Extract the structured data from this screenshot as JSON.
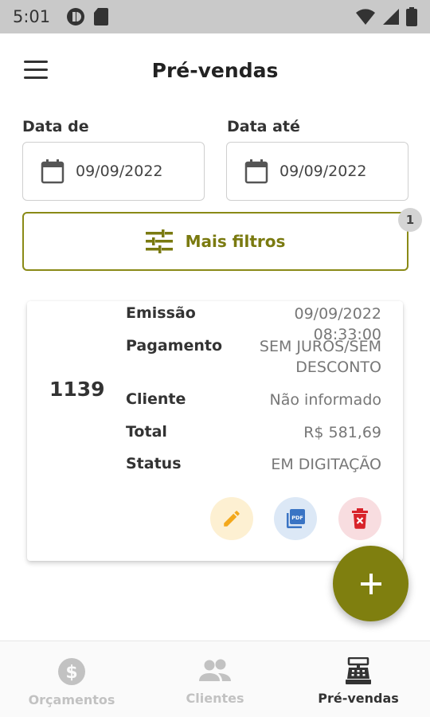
{
  "status_bar": {
    "time": "5:01",
    "icons": [
      "clock-badge-icon",
      "sd-card-icon",
      "wifi-icon",
      "signal-icon",
      "battery-icon"
    ]
  },
  "header": {
    "title": "Pré-vendas",
    "menu_icon": "hamburger-menu-icon"
  },
  "filters": {
    "date_from": {
      "label": "Data de",
      "value": "09/09/2022",
      "icon": "calendar-icon"
    },
    "date_to": {
      "label": "Data até",
      "value": "09/09/2022",
      "icon": "calendar-icon"
    },
    "more_filters": {
      "label": "Mais filtros",
      "icon": "tune-icon",
      "badge": "1"
    }
  },
  "card": {
    "number": "1139",
    "rows": [
      {
        "label": "Emissão",
        "value": "09/09/2022 08:33:00"
      },
      {
        "label": "Pagamento",
        "value": "SEM JUROS/SEM DESCONTO"
      },
      {
        "label": "Cliente",
        "value": "Não informado"
      },
      {
        "label": "Total",
        "value": "R$ 581,69"
      },
      {
        "label": "Status",
        "value": "EM DIGITAÇÃO"
      }
    ],
    "actions": [
      "edit-icon",
      "pdf-icon",
      "delete-icon"
    ]
  },
  "fab": {
    "icon": "plus-icon"
  },
  "bottom_nav": {
    "items": [
      {
        "label": "Orçamentos",
        "icon": "dollar-circle-icon",
        "active": false
      },
      {
        "label": "Clientes",
        "icon": "people-icon",
        "active": false
      },
      {
        "label": "Pré-vendas",
        "icon": "cash-register-icon",
        "active": true
      }
    ]
  },
  "colors": {
    "accent": "#7f7f0f",
    "edit_bg": "#fdf0d2",
    "edit_icon": "#f3a81b",
    "pdf_bg": "#dce8f6",
    "pdf_icon": "#3a74c4",
    "delete_bg": "#f8dde0",
    "delete_icon": "#d8232a"
  }
}
